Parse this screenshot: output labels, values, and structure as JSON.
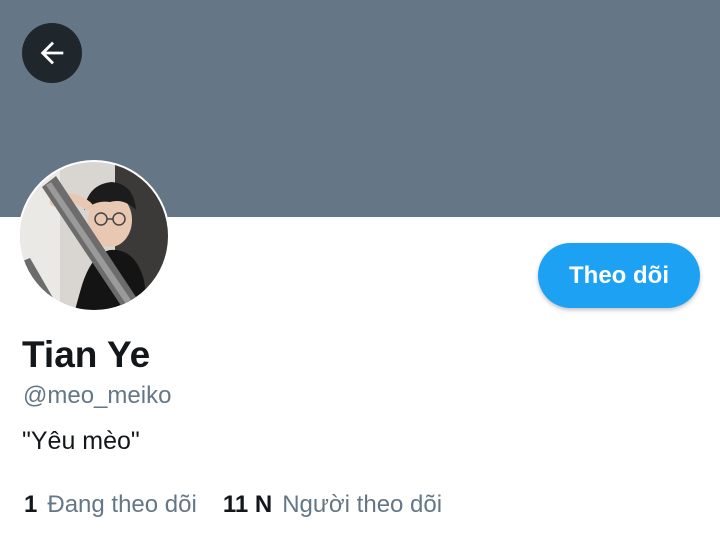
{
  "profile": {
    "display_name": "Tian Ye",
    "handle": "@meo_meiko",
    "bio": "\"Yêu mèo\"",
    "following_count": "1",
    "following_label": "Đang theo dõi",
    "followers_count": "11 N",
    "followers_label": "Người theo dõi",
    "follow_button_label": "Theo dõi"
  },
  "icons": {
    "back": "arrow-left-icon"
  },
  "colors": {
    "banner": "#657786",
    "accent": "#1da1f2",
    "text_primary": "#14171a",
    "text_secondary": "#657786",
    "back_button": "#1f262c"
  }
}
